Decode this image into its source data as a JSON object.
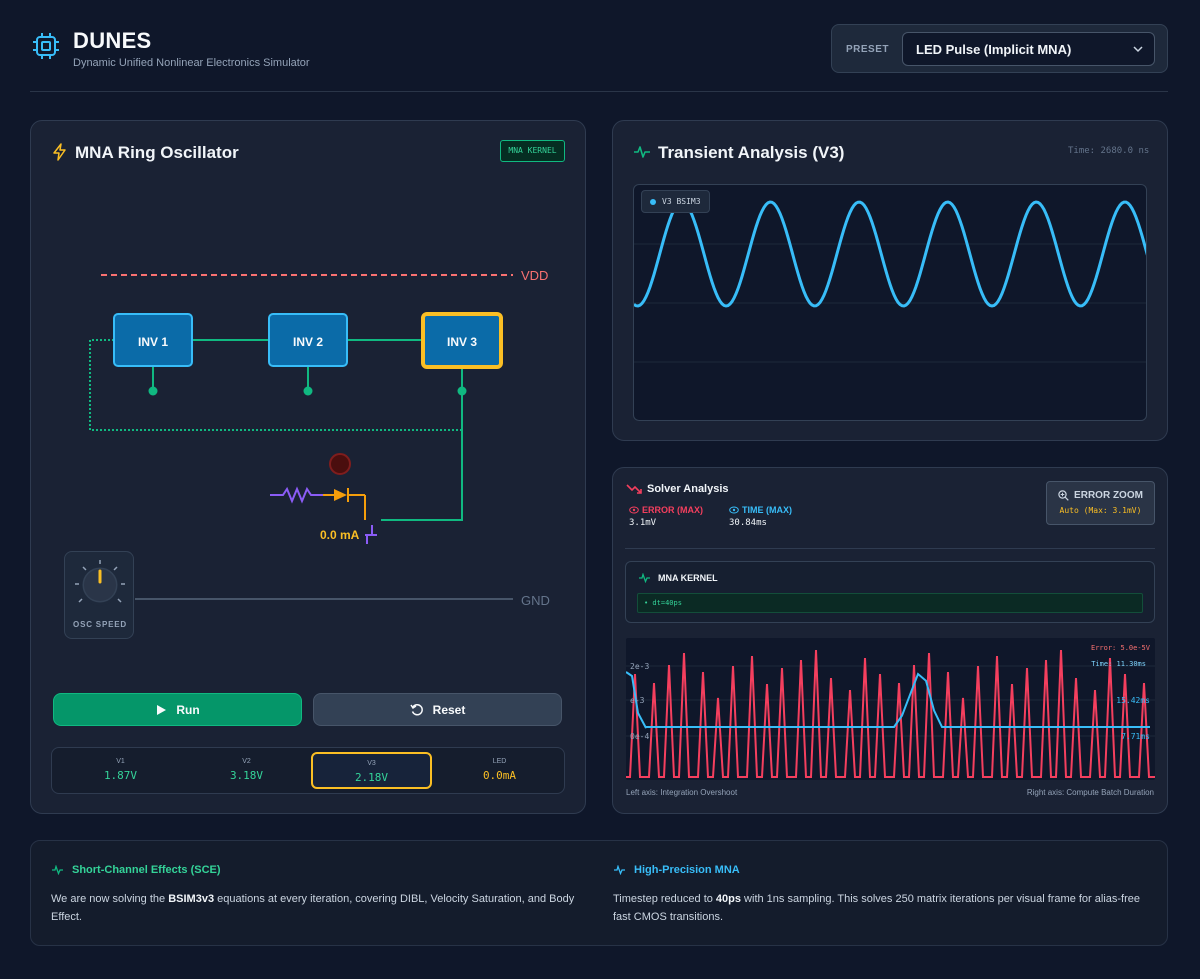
{
  "app": {
    "title": "DUNES",
    "subtitle": "Dynamic Unified Nonlinear Electronics Simulator"
  },
  "preset": {
    "label": "PRESET",
    "selected": "LED Pulse (Implicit MNA)"
  },
  "circuit_panel": {
    "title": "MNA Ring Oscillator",
    "badge": "MNA KERNEL",
    "vdd_label": "VDD",
    "gnd_label": "GND",
    "inverters": [
      "INV 1",
      "INV 2",
      "INV 3"
    ],
    "active_inverter": "INV 3",
    "led_current_label": "0.0 mA",
    "knob_label": "OSC SPEED",
    "run_label": "Run",
    "reset_label": "Reset",
    "readouts": [
      {
        "label": "V1",
        "value": "1.87V",
        "color": "#34d399"
      },
      {
        "label": "V2",
        "value": "3.18V",
        "color": "#34d399"
      },
      {
        "label": "V3",
        "value": "2.18V",
        "color": "#34d399"
      },
      {
        "label": "LED",
        "value": "0.0mA",
        "color": "#fbbf24"
      }
    ]
  },
  "transient_panel": {
    "title": "Transient Analysis (V3)",
    "time_label": "Time: 2680.0 ns",
    "legend": "V3 BSIM3"
  },
  "solver_panel": {
    "title": "Solver Analysis",
    "error_label": "ERROR (MAX)",
    "error_value": "3.1mV",
    "time_label": "TIME (MAX)",
    "time_value": "30.84ms",
    "zoom_title": "ERROR ZOOM",
    "zoom_sub": "Auto (Max: 3.1mV)",
    "kernel_title": "MNA KERNEL",
    "kernel_chip": "• dt=40ps",
    "chart_error_label": "Error: 5.0e-5V",
    "chart_time_label": "Time: 11.30ms",
    "left_ticks": [
      "2e-3",
      "e-3",
      "0e-4"
    ],
    "right_ticks": [
      "15.42ms",
      "7.71ms"
    ],
    "left_axis_note": "Left axis: Integration Overshoot",
    "right_axis_note": "Right axis: Compute Batch Duration"
  },
  "info": {
    "sce_title": "Short-Channel Effects (SCE)",
    "sce_pre": "We are now solving the ",
    "sce_bold": "BSIM3v3",
    "sce_post": " equations at every iteration, covering DIBL, Velocity Saturation, and Body Effect.",
    "mna_title": "High-Precision MNA",
    "mna_pre": "Timestep reduced to ",
    "mna_bold": "40ps",
    "mna_post": " with 1ns sampling. This solves 250 matrix iterations per visual frame for alias-free fast CMOS transitions."
  },
  "colors": {
    "accent_green": "#10b981",
    "accent_blue": "#38bdf8",
    "accent_amber": "#fbbf24",
    "error_red": "#f43f5e",
    "vdd_red": "#f87171"
  },
  "chart_data": [
    {
      "type": "line",
      "title": "Transient Analysis (V3)",
      "series": [
        {
          "name": "V3 BSIM3",
          "cycles": 5.8,
          "phase_start": "rising from minimum"
        }
      ]
    },
    {
      "type": "line",
      "title": "Solver Analysis",
      "series": [
        {
          "name": "Integration Overshoot",
          "axis": "left"
        },
        {
          "name": "Compute Batch Duration",
          "axis": "right"
        }
      ]
    }
  ]
}
